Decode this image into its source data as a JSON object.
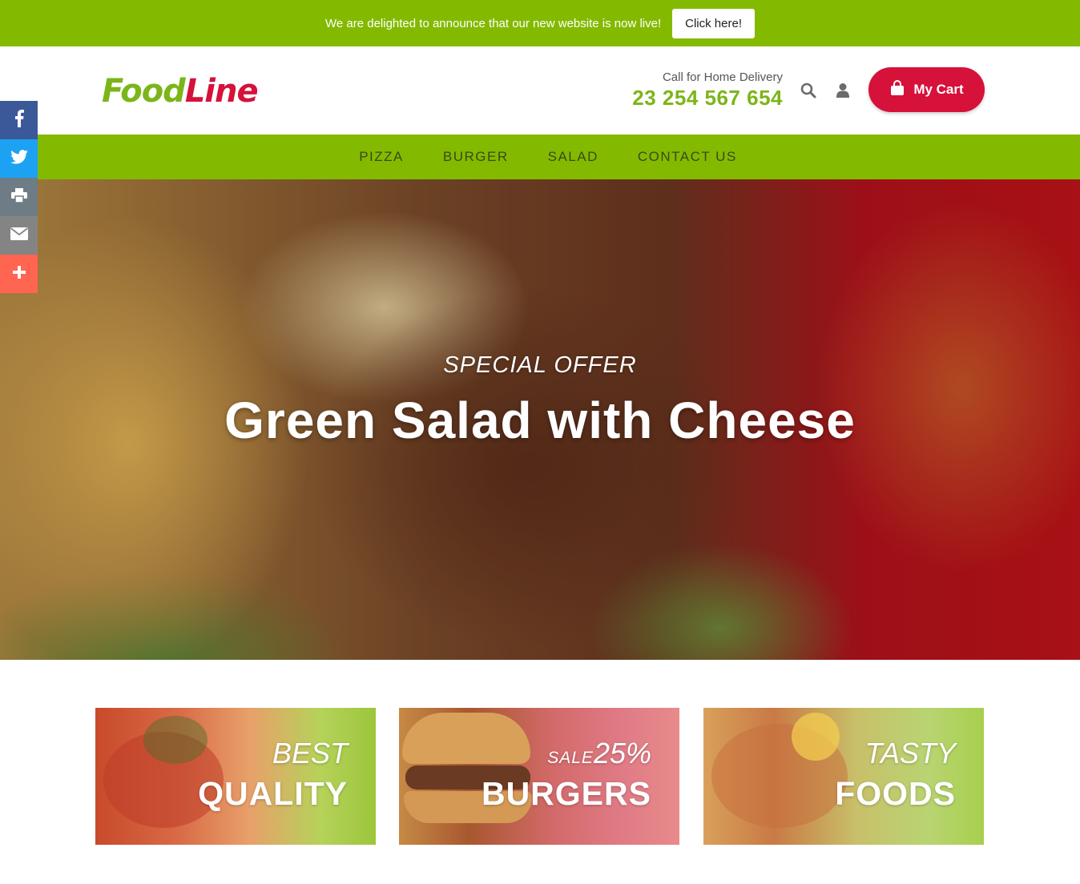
{
  "announcement": {
    "text": "We are delighted to announce that our new website is now live!",
    "button_label": "Click here!"
  },
  "header": {
    "logo": {
      "part1": "Food",
      "part2": "Line"
    },
    "phone_label": "Call for Home Delivery",
    "phone_number": "23 254 567 654",
    "cart_label": "My Cart"
  },
  "nav": {
    "items": [
      {
        "label": "PIZZA"
      },
      {
        "label": "BURGER"
      },
      {
        "label": "SALAD"
      },
      {
        "label": "CONTACT US"
      }
    ]
  },
  "social": {
    "items": [
      {
        "icon": "facebook-icon",
        "color": "#3b5998"
      },
      {
        "icon": "twitter-icon",
        "color": "#1da1f2"
      },
      {
        "icon": "print-icon",
        "color": "#6d7c85"
      },
      {
        "icon": "email-icon",
        "color": "#848484"
      },
      {
        "icon": "plus-icon",
        "color": "#ff6550"
      }
    ]
  },
  "hero": {
    "subtitle": "SPECIAL OFFER",
    "title": "Green Salad with Cheese"
  },
  "promos": [
    {
      "top": "BEST",
      "bottom": "QUALITY"
    },
    {
      "top_small": "SALE",
      "top": "25%",
      "bottom": "BURGERS"
    },
    {
      "top": "TASTY",
      "bottom": "FOODS"
    }
  ],
  "colors": {
    "brand_green": "#83ba00",
    "brand_red": "#d6113a",
    "phone_green": "#7cb518"
  }
}
